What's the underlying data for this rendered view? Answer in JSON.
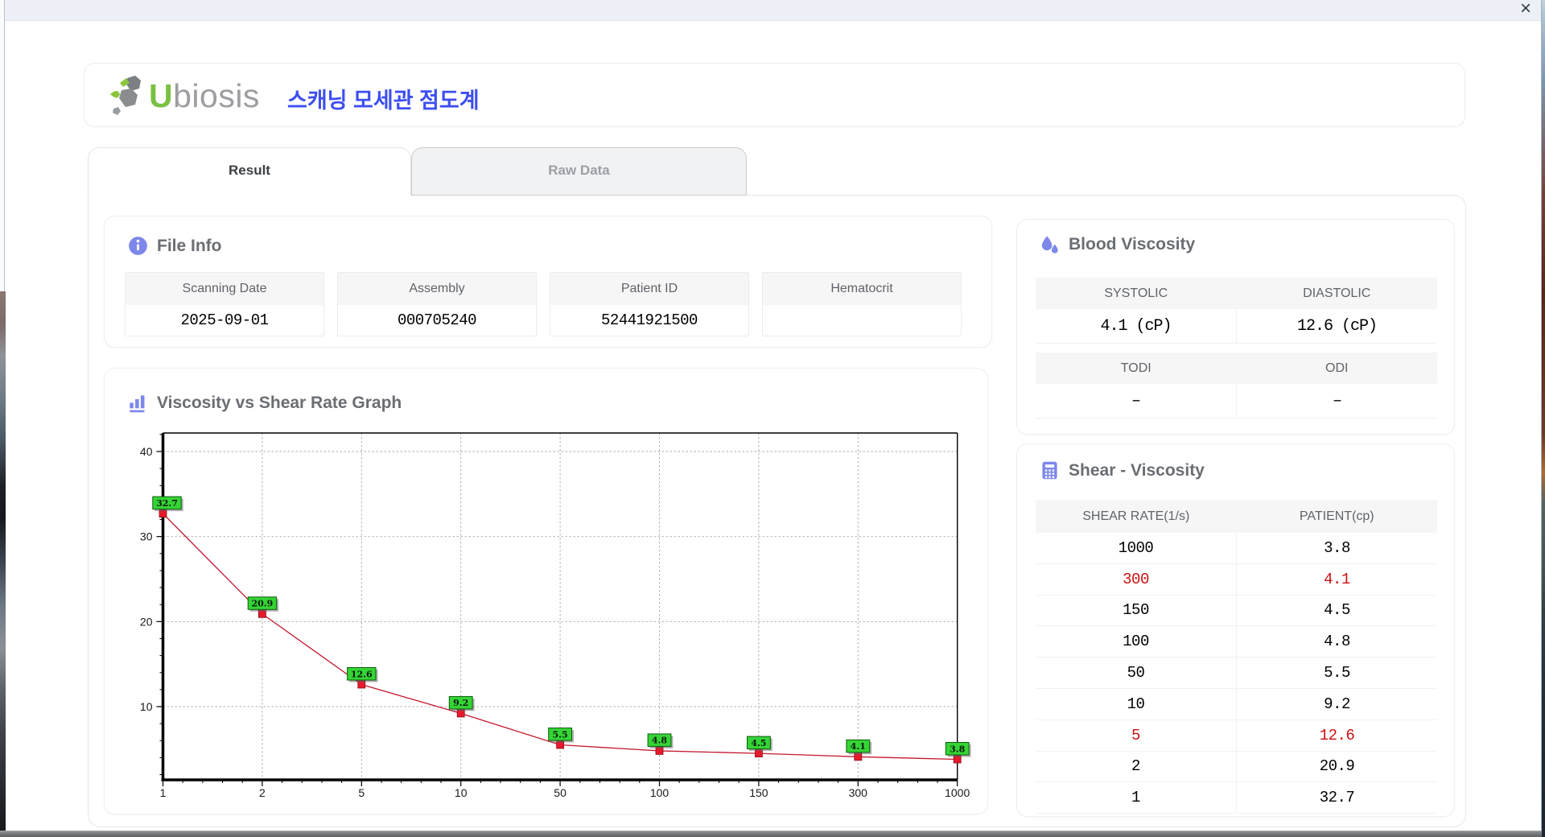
{
  "window": {
    "close_label": "×"
  },
  "brand": {
    "logo_u": "U",
    "logo_rest": "biosis",
    "app_title_ko": "스캐닝 모세관 점도계"
  },
  "tabs": {
    "result": "Result",
    "raw": "Raw Data"
  },
  "file_info": {
    "title": "File Info",
    "fields": [
      {
        "label": "Scanning Date",
        "value": "2025-09-01"
      },
      {
        "label": "Assembly",
        "value": "000705240"
      },
      {
        "label": "Patient ID",
        "value": "52441921500"
      },
      {
        "label": "Hematocrit",
        "value": ""
      }
    ]
  },
  "graph": {
    "title": "Viscosity vs Shear Rate Graph"
  },
  "chart_data": {
    "type": "line",
    "title": "Viscosity vs Shear Rate Graph",
    "categories": [
      "1",
      "2",
      "5",
      "10",
      "50",
      "100",
      "150",
      "300",
      "1000"
    ],
    "values": [
      32.7,
      20.9,
      12.6,
      9.2,
      5.5,
      4.8,
      4.5,
      4.1,
      3.8
    ],
    "yticks": [
      10,
      20,
      30,
      40
    ],
    "ylim": [
      1.4,
      42.2
    ],
    "xlabel": "",
    "ylabel": "",
    "grid": "dashed",
    "line_color": "#c4182f",
    "marker_color": "#e8192c",
    "label_bg": "#35d435"
  },
  "blood_viscosity": {
    "title": "Blood Viscosity",
    "groups": [
      {
        "headers": [
          "SYSTOLIC",
          "DIASTOLIC"
        ],
        "values": [
          "4.1 (cP)",
          "12.6 (cP)"
        ]
      },
      {
        "headers": [
          "TODI",
          "ODI"
        ],
        "values": [
          "–",
          "–"
        ]
      }
    ]
  },
  "shear": {
    "title": "Shear - Viscosity",
    "headers": [
      "SHEAR RATE(1/s)",
      "PATIENT(cp)"
    ],
    "rows": [
      {
        "rate": "1000",
        "value": "3.8",
        "highlight": false
      },
      {
        "rate": "300",
        "value": "4.1",
        "highlight": true
      },
      {
        "rate": "150",
        "value": "4.5",
        "highlight": false
      },
      {
        "rate": "100",
        "value": "4.8",
        "highlight": false
      },
      {
        "rate": "50",
        "value": "5.5",
        "highlight": false
      },
      {
        "rate": "10",
        "value": "9.2",
        "highlight": false
      },
      {
        "rate": "5",
        "value": "12.6",
        "highlight": true
      },
      {
        "rate": "2",
        "value": "20.9",
        "highlight": false
      },
      {
        "rate": "1",
        "value": "32.7",
        "highlight": false
      }
    ]
  },
  "colors": {
    "accent": "#7d88ea",
    "highlight_red": "#cc1111",
    "title_blue": "#3d4ef2",
    "logo_green": "#7ac143"
  }
}
